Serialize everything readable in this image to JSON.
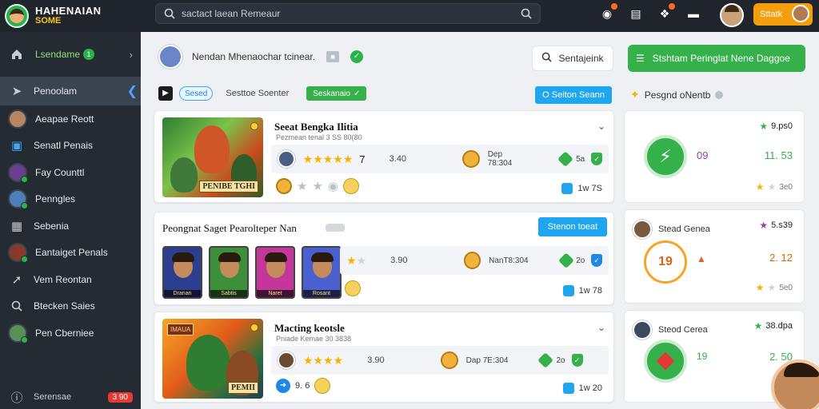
{
  "app": {
    "logo_line1": "HAHENAIAN",
    "logo_line2": "SOME"
  },
  "topbar": {
    "search_placeholder": "sactact laean Remeaur",
    "user_chip_label": "Sttatk",
    "icons": [
      "bell-icon",
      "book-icon",
      "flame-icon",
      "chat-icon"
    ]
  },
  "sidebar": {
    "header_label": "Lsendame",
    "header_badge": "1",
    "items": [
      {
        "label": "Penoolam",
        "icon": "cursor-icon",
        "active": true
      },
      {
        "label": "Aeapae Reott",
        "icon": "avatar"
      },
      {
        "label": "Senatl Penais",
        "icon": "cube-icon"
      },
      {
        "label": "Fay Counttl",
        "icon": "avatar"
      },
      {
        "label": "Penngles",
        "icon": "avatar"
      },
      {
        "label": "Sebenia",
        "icon": "cube-icon"
      },
      {
        "label": "Eantaiget Penals",
        "icon": "avatar"
      },
      {
        "label": "Vem Reontan",
        "icon": "cursor-icon"
      },
      {
        "label": "Btecken Saies",
        "icon": "search-icon"
      },
      {
        "label": "Pen Cberniee",
        "icon": "avatar"
      }
    ],
    "footer_label": "Serensae",
    "footer_badge": "3 90"
  },
  "header": {
    "title": "Nendan Mhenaochar tcinear.",
    "white_button": "Sentajeink",
    "green_button": "Stshtam Peringlat Nene Daggoe"
  },
  "filters": {
    "chip": "Sesed",
    "text": "Sesttoe Soenter",
    "green_chip": "Seskanaio",
    "blue_button": "O Seiton Seann",
    "right_label": "Pesgnd oNentb"
  },
  "cards": [
    {
      "title": "Seeat Bengka Ilitia",
      "subtitle": "Pezmean tenal 3 SS 80(80",
      "thumb_label": "PENIBE TGHI",
      "rating_number": "7",
      "value": "3.40",
      "code": "Dep 78:304",
      "gem_text": "5a",
      "foot_value": "1w 7S",
      "foot_tag": "1"
    },
    {
      "title": "Peongnat Saget Pearolteper Nan",
      "blue_button": "Stenon toeat",
      "value": "3.90",
      "code": "NanT8:304",
      "gem_text": "2o",
      "foot_value": "1w 78",
      "portraits": [
        "Dranan",
        "Sabtis",
        "Naret",
        "Rosant"
      ]
    },
    {
      "title": "Macting keotsle",
      "subtitle": "Pniade Kemae 30 3838",
      "thumb_tag": "IMAUA",
      "thumb_label": "PEMII",
      "value": "3.90",
      "code": "Dap 7E:304",
      "gem_text": "2o",
      "foot_value": "1w 20",
      "foot_left": "9. 6"
    }
  ],
  "right_panel": [
    {
      "top_stat": "9.ps0",
      "mid": "09",
      "big": "11. 53",
      "foot": "3e0"
    },
    {
      "title": "Stead Genea",
      "top_stat": "5.s39",
      "circle": "19",
      "big": "2. 12",
      "foot": "5e0"
    },
    {
      "title": "Steod Cerea",
      "top_stat": "38.dpa",
      "mid": "19",
      "big": "2. 50"
    }
  ]
}
